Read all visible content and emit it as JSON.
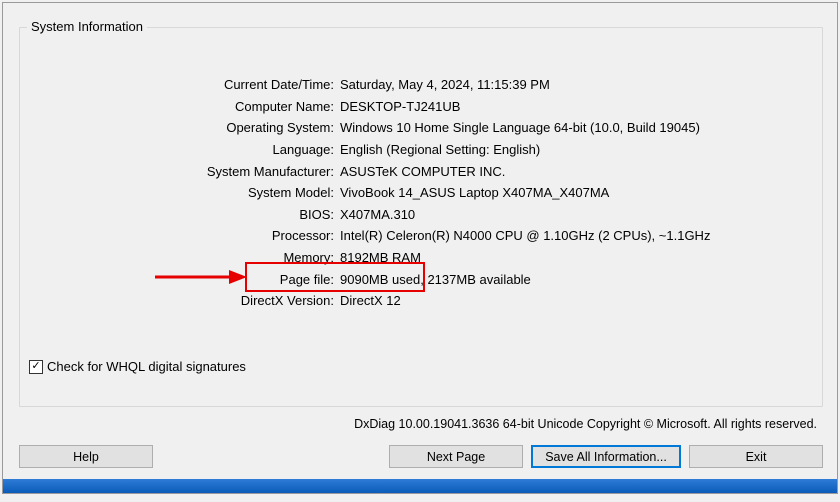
{
  "group_title": "System Information",
  "rows": [
    {
      "label": "Current Date/Time:",
      "value": "Saturday, May 4, 2024, 11:15:39 PM"
    },
    {
      "label": "Computer Name:",
      "value": "DESKTOP-TJ241UB"
    },
    {
      "label": "Operating System:",
      "value": "Windows 10 Home Single Language 64-bit (10.0, Build 19045)"
    },
    {
      "label": "Language:",
      "value": "English (Regional Setting: English)"
    },
    {
      "label": "System Manufacturer:",
      "value": "ASUSTeK COMPUTER INC."
    },
    {
      "label": "System Model:",
      "value": "VivoBook 14_ASUS Laptop X407MA_X407MA"
    },
    {
      "label": "BIOS:",
      "value": "X407MA.310"
    },
    {
      "label": "Processor:",
      "value": "Intel(R) Celeron(R) N4000 CPU @ 1.10GHz (2 CPUs), ~1.1GHz"
    },
    {
      "label": "Memory:",
      "value": "8192MB RAM"
    },
    {
      "label": "Page file:",
      "value": "9090MB used, 2137MB available"
    },
    {
      "label": "DirectX Version:",
      "value": "DirectX 12"
    }
  ],
  "checkbox": {
    "checked": true,
    "label": "Check for WHQL digital signatures"
  },
  "copyright": "DxDiag 10.00.19041.3636 64-bit Unicode  Copyright © Microsoft. All rights reserved.",
  "buttons": {
    "help": "Help",
    "next_page": "Next Page",
    "save": "Save All Information...",
    "exit": "Exit"
  }
}
